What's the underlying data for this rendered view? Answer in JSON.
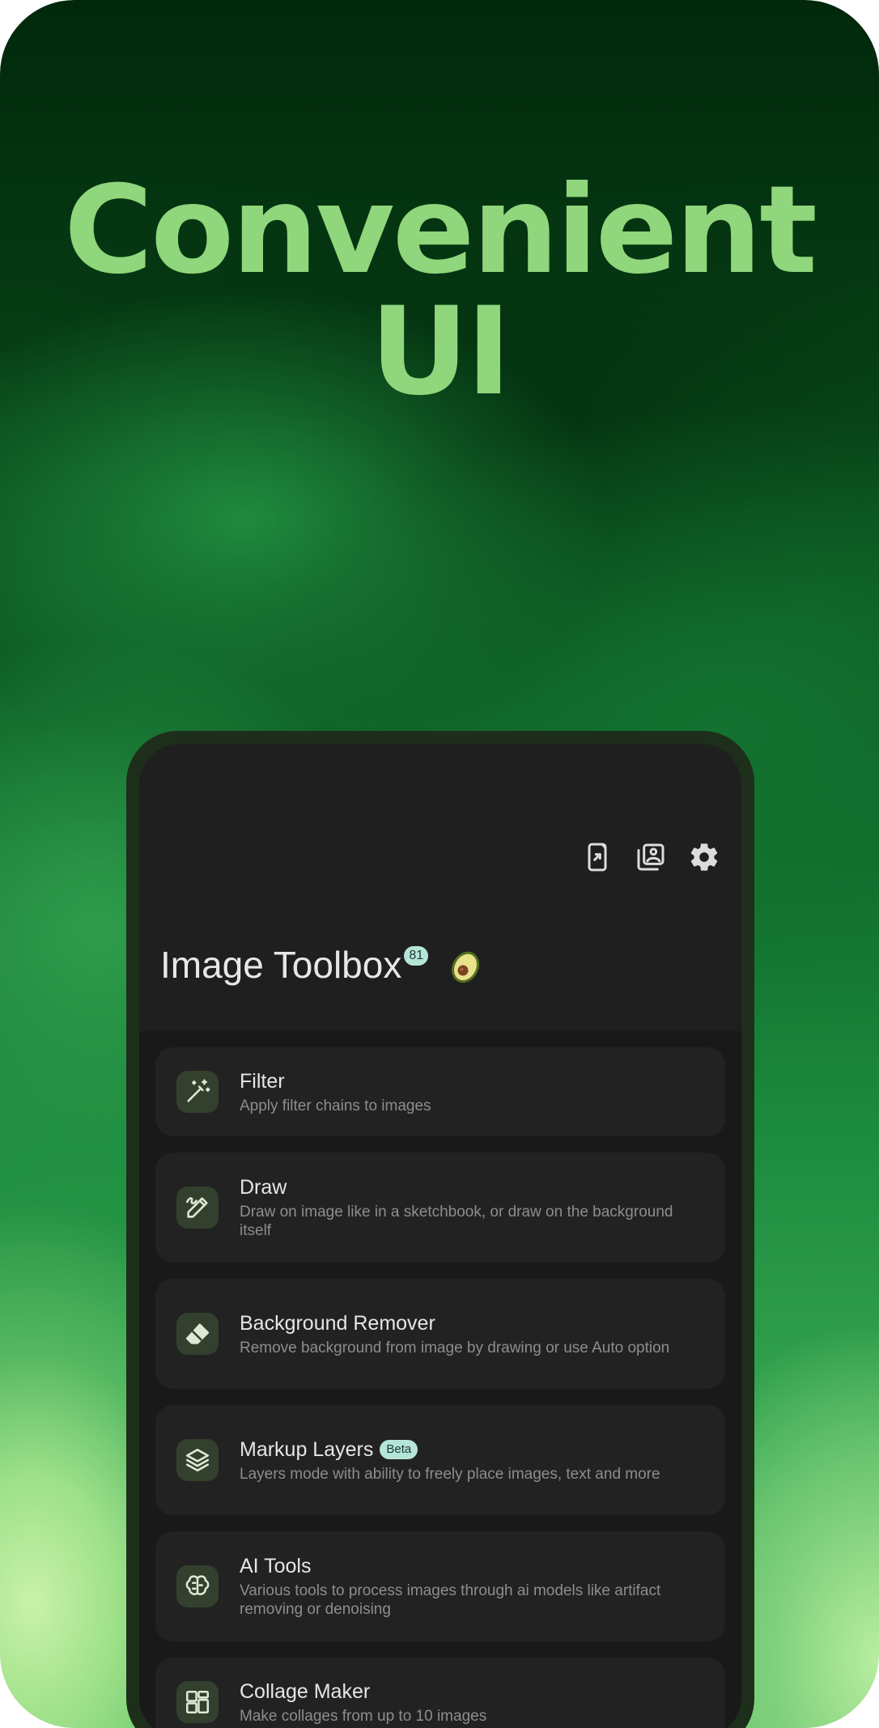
{
  "headline": {
    "line1": "Convenient",
    "line2": "UI"
  },
  "app": {
    "title": "Image Toolbox",
    "version_badge": "81",
    "emoji_icon": "avocado-icon"
  },
  "toolbar": {
    "icons": [
      "share-to-app-icon",
      "image-stack-icon",
      "settings-gear-icon"
    ]
  },
  "tools": [
    {
      "title": "Filter",
      "description": "Apply filter chains to images",
      "icon": "magic-wand-icon"
    },
    {
      "title": "Draw",
      "description": "Draw on image like in a sketchbook, or draw on the background itself",
      "icon": "pencil-draw-icon"
    },
    {
      "title": "Background Remover",
      "description": "Remove background from image by drawing or use Auto option",
      "icon": "eraser-icon"
    },
    {
      "title": "Markup Layers",
      "badge": "Beta",
      "description": "Layers mode with ability to freely place images, text and more",
      "icon": "layers-icon"
    },
    {
      "title": "AI Tools",
      "description": "Various tools to process images through ai models like artifact removing or denoising",
      "icon": "brain-icon"
    },
    {
      "title": "Collage Maker",
      "description": "Make collages from up to 10 images",
      "icon": "collage-grid-icon"
    }
  ],
  "colors": {
    "headline": "#8fd67c",
    "phone_frame": "#1d2f1b",
    "screen_bg": "#1f1f1f",
    "card_bg": "#222222",
    "icon_tile": "#33402d",
    "icon_fg": "#dfe8d6",
    "badge_bg": "#b5e4d8"
  }
}
